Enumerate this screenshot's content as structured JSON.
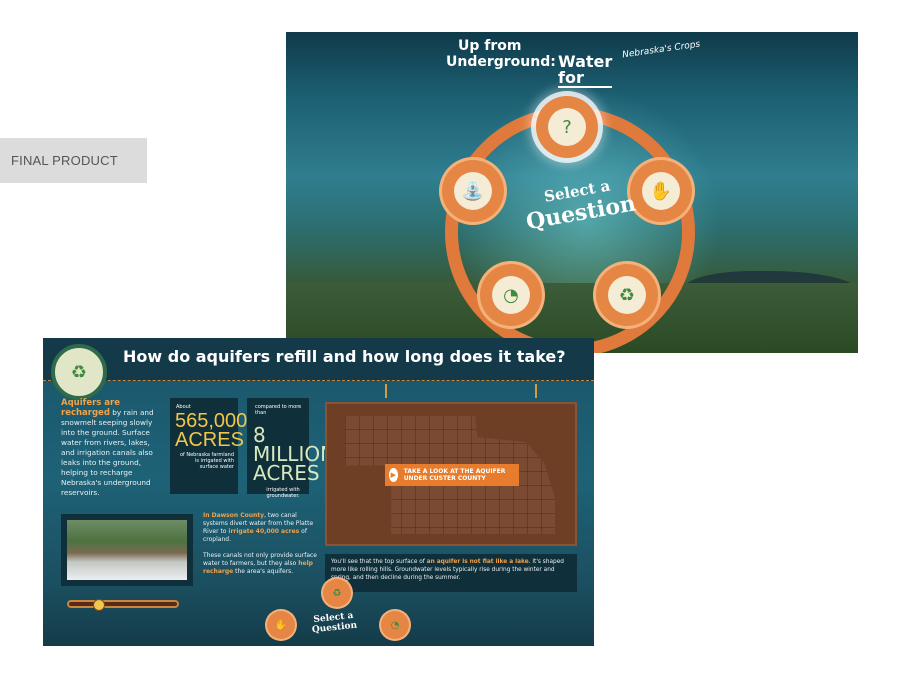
{
  "label": "FINAL PRODUCT",
  "top_screen": {
    "title_line1": "Up from",
    "title_line2": "Underground:",
    "title_line3": "Water for",
    "title_line4": "Nebraska's Crops",
    "center_line1": "Select a",
    "center_line2": "Question",
    "nodes": [
      {
        "icon": "question-rock-icon"
      },
      {
        "icon": "hands-water-icon"
      },
      {
        "icon": "refill-cycle-icon"
      },
      {
        "icon": "gauge-drop-icon"
      },
      {
        "icon": "fountain-icon"
      }
    ]
  },
  "bottom_screen": {
    "title": "How do aquifers refill and how long does it take?",
    "intro_highlight": "Aquifers are recharged",
    "intro_text": " by rain and snowmelt seeping slowly into the ground. Surface water from rivers, lakes, and irrigation canals also leaks into the ground, helping to recharge Nebraska's underground reservoirs.",
    "stat1_about": "About",
    "stat1_big": "565,000 ACRES",
    "stat1_small": "of Nebraska farmland is irrigated with surface water",
    "stat2_compare": "compared to more than",
    "stat2_big": "8 MILLION ACRES",
    "stat2_small": "irrigated with groundwater.",
    "map_cta": "TAKE A LOOK AT THE AQUIFER UNDER CUSTER COUNTY",
    "dawson_hl": "In Dawson County",
    "dawson_text1": ", two canal systems divert water from the Platte River to ",
    "dawson_hl2": "irrigate 40,000 acres",
    "dawson_text2": " of cropland.",
    "dawson_text3": "These canals not only provide surface water to farmers, but they also ",
    "dawson_hl3": "help recharge",
    "dawson_text4": " the area's aquifers.",
    "note_text1": "You'll see that the top surface of ",
    "note_hl": "an aquifer is not flat like a lake",
    "note_text2": ". It's shaped more like rolling hills. Groundwater levels typically rise during the winter and spring, and then decline during the summer.",
    "mini_select_a": "Select a",
    "mini_question": "Question"
  }
}
